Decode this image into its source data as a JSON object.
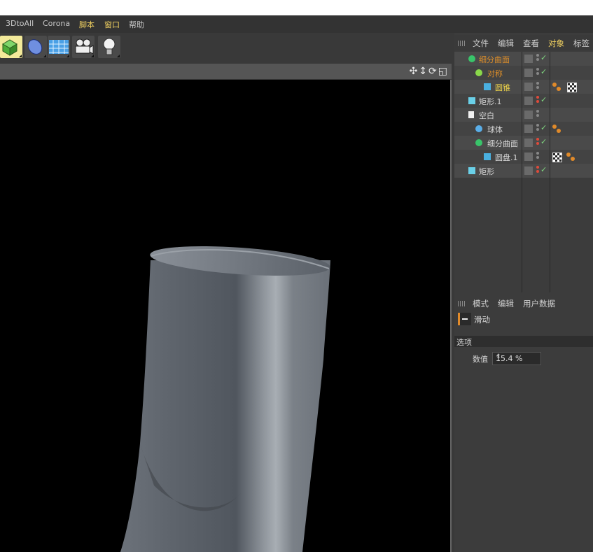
{
  "menubar": {
    "items": [
      {
        "label": "3DtoAll",
        "highlight": false
      },
      {
        "label": "Corona",
        "highlight": false
      },
      {
        "label": "脚本",
        "highlight": true
      },
      {
        "label": "窗口",
        "highlight": true
      },
      {
        "label": "帮助",
        "highlight": false
      }
    ]
  },
  "toolbar": {
    "buttons": [
      {
        "icon": "subdivision-cube-icon",
        "active": true
      },
      {
        "icon": "deformer-blue-icon",
        "active": false
      },
      {
        "icon": "floor-grid-icon",
        "active": false
      },
      {
        "icon": "camera-icon",
        "active": false
      },
      {
        "icon": "light-bulb-icon",
        "active": false
      }
    ]
  },
  "viewport": {
    "nav_icons": "✣↕⟳◱"
  },
  "object_manager": {
    "menu": [
      {
        "label": "文件",
        "highlight": false
      },
      {
        "label": "编辑",
        "highlight": false
      },
      {
        "label": "查看",
        "highlight": false
      },
      {
        "label": "对象",
        "highlight": true
      },
      {
        "label": "标签",
        "highlight": false
      }
    ],
    "objects": [
      {
        "name": "细分曲面",
        "indent": 0,
        "color": "orange",
        "icon": "subdivision-icon",
        "layer": "check",
        "tags": []
      },
      {
        "name": "对称",
        "indent": 1,
        "color": "orange",
        "icon": "symmetry-icon",
        "layer": "check",
        "tags": []
      },
      {
        "name": "圆锥",
        "indent": 2,
        "color": "yellow",
        "icon": "cone-icon",
        "layer": "none",
        "tags": [
          "material",
          "checker"
        ]
      },
      {
        "name": "矩形.1",
        "indent": 0,
        "color": "normal",
        "icon": "spline-icon",
        "layer": "check-red",
        "tags": []
      },
      {
        "name": "空白",
        "indent": 0,
        "color": "normal",
        "icon": "null-icon",
        "layer": "none",
        "tags": []
      },
      {
        "name": "球体",
        "indent": 1,
        "color": "normal",
        "icon": "sphere-icon",
        "layer": "check",
        "tags": [
          "material"
        ]
      },
      {
        "name": "细分曲面",
        "indent": 1,
        "color": "normal",
        "icon": "subdivision-icon",
        "layer": "check-red",
        "tags": []
      },
      {
        "name": "圆盘.1",
        "indent": 2,
        "color": "normal",
        "icon": "disc-icon",
        "layer": "none",
        "tags": [
          "checker",
          "material"
        ]
      },
      {
        "name": "矩形",
        "indent": 0,
        "color": "normal",
        "icon": "spline-icon",
        "layer": "check-red",
        "tags": []
      }
    ]
  },
  "attribute_manager": {
    "menu": [
      "模式",
      "编辑",
      "用户数据"
    ],
    "title": "滑动",
    "section": "选项",
    "param_label": "数值",
    "param_value": "15.4 %"
  },
  "colors": {
    "bg": "#393939",
    "accent": "#f0d060",
    "orange": "#d98c2a",
    "active_button": "#f3ea9a"
  }
}
